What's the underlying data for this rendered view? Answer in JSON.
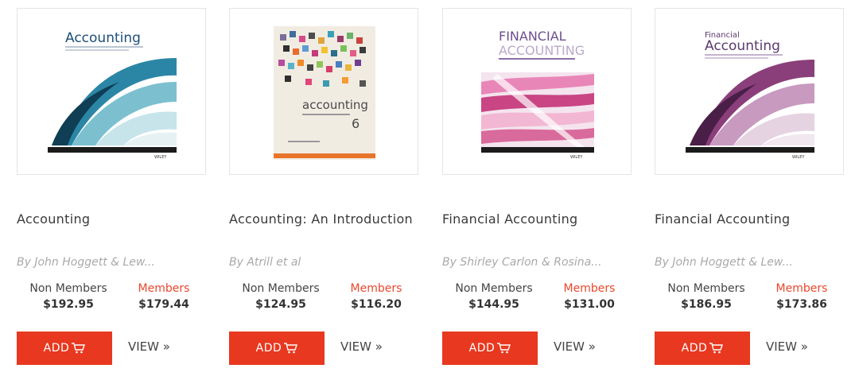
{
  "colors": {
    "accent_red": "#e8381f",
    "members_red": "#e8472d",
    "author_gray": "#a9a9a9"
  },
  "products": [
    {
      "title": "Accounting",
      "author": "By John Hoggett & Lew...",
      "cover_title": "Accounting",
      "non_members_label": "Non Members",
      "members_label": "Members",
      "non_members_price": "$192.95",
      "members_price": "$179.44",
      "add_label": "ADD",
      "view_label": "VIEW »"
    },
    {
      "title": "Accounting: An Introduction",
      "author": "By Atrill et al",
      "cover_title": "accounting",
      "cover_edition": "6",
      "non_members_label": "Non Members",
      "members_label": "Members",
      "non_members_price": "$124.95",
      "members_price": "$116.20",
      "add_label": "ADD",
      "view_label": "VIEW »"
    },
    {
      "title": "Financial Accounting",
      "author": "By Shirley Carlon & Rosina...",
      "cover_title_line1": "FINANCIAL",
      "cover_title_line2": "ACCOUNTING",
      "non_members_label": "Non Members",
      "members_label": "Members",
      "non_members_price": "$144.95",
      "members_price": "$131.00",
      "add_label": "ADD",
      "view_label": "VIEW »"
    },
    {
      "title": "Financial Accounting",
      "author": "By John Hoggett & Lew...",
      "cover_title_line1": "Financial",
      "cover_title_line2": "Accounting",
      "non_members_label": "Non Members",
      "members_label": "Members",
      "non_members_price": "$186.95",
      "members_price": "$173.86",
      "add_label": "ADD",
      "view_label": "VIEW »"
    }
  ]
}
